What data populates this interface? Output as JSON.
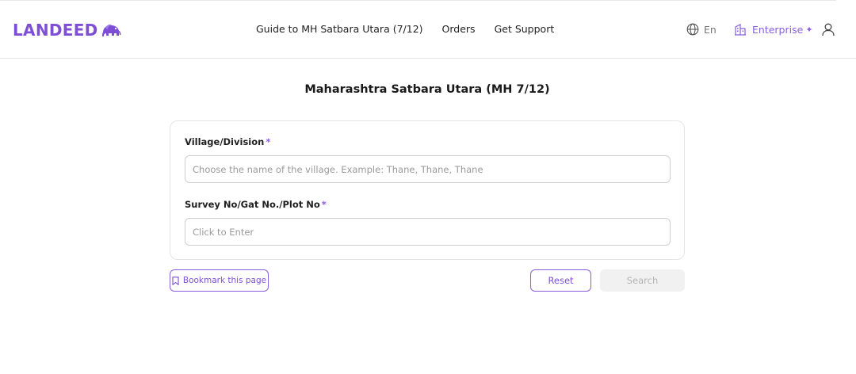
{
  "brand": {
    "name": "LANDEED",
    "logo_icon": "elephant-logo-icon",
    "accent_color": "#7e4fd6"
  },
  "nav": {
    "links": [
      {
        "label": "Guide to MH Satbara Utara (7/12)"
      },
      {
        "label": "Orders"
      },
      {
        "label": "Get Support"
      }
    ],
    "language": {
      "label": "En",
      "icon": "globe-icon"
    },
    "enterprise": {
      "label": "Enterprise",
      "icon": "building-icon",
      "badge_icon": "sparkle-icon"
    },
    "account_icon": "user-icon"
  },
  "page": {
    "title": "Maharashtra Satbara Utara (MH 7/12)"
  },
  "form": {
    "village": {
      "label": "Village/Division",
      "required_mark": "*",
      "value": "",
      "placeholder": "Choose the name of the village. Example: Thane, Thane, Thane"
    },
    "survey": {
      "label": "Survey No/Gat No./Plot No",
      "required_mark": "*",
      "value": "",
      "placeholder": "Click to Enter"
    }
  },
  "actions": {
    "bookmark_label": "Bookmark this page",
    "bookmark_icon": "bookmark-icon",
    "reset_label": "Reset",
    "search_label": "Search",
    "search_disabled": true
  }
}
